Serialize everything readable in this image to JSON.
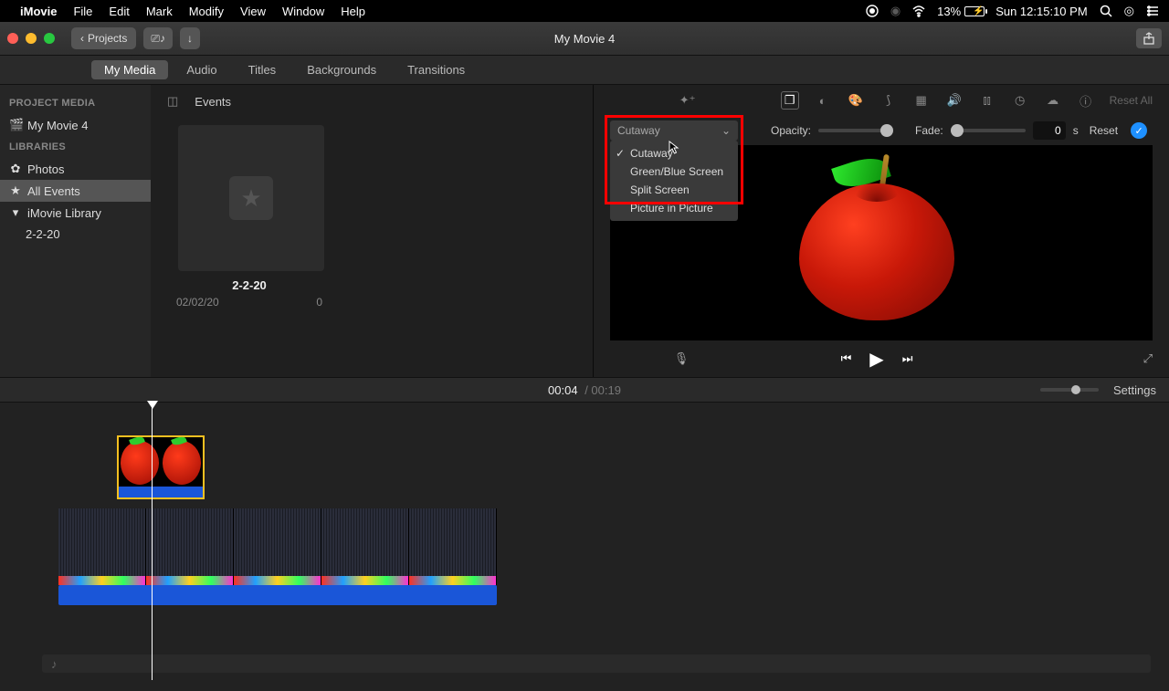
{
  "menubar": {
    "app": "iMovie",
    "items": [
      "File",
      "Edit",
      "Mark",
      "Modify",
      "View",
      "Window",
      "Help"
    ],
    "battery_pct": "13%",
    "clock": "Sun 12:15:10 PM"
  },
  "toolbar": {
    "back_label": "Projects",
    "title": "My Movie 4"
  },
  "tabs": {
    "items": [
      "My Media",
      "Audio",
      "Titles",
      "Backgrounds",
      "Transitions"
    ],
    "active": 0
  },
  "sidebar": {
    "heads": {
      "project": "PROJECT MEDIA",
      "libraries": "LIBRARIES"
    },
    "project_item": "My Movie 4",
    "lib_items": [
      "Photos",
      "All Events"
    ],
    "library_label": "iMovie Library",
    "library_children": [
      "2-2-20"
    ]
  },
  "browser": {
    "header": "Events",
    "thumb_caption": "2-2-20",
    "date": "02/02/20",
    "count": "0"
  },
  "viewer": {
    "reset_all": "Reset All",
    "dropdown_selected": "Cutaway",
    "dropdown_options": [
      "Cutaway",
      "Green/Blue Screen",
      "Split Screen",
      "Picture in Picture"
    ],
    "opacity_label": "Opacity:",
    "fade_label": "Fade:",
    "fade_value": "0",
    "fade_unit": "s",
    "reset": "Reset"
  },
  "timeline": {
    "current": "00:04",
    "duration": "00:19",
    "settings": "Settings"
  }
}
